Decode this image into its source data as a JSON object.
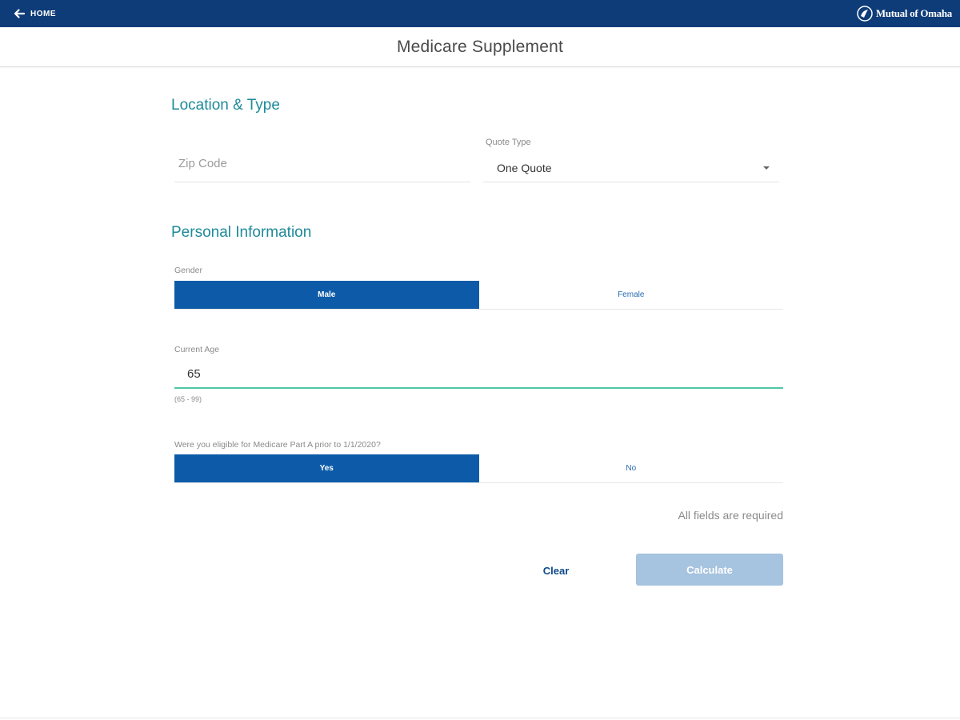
{
  "header": {
    "home_label": "HOME",
    "brand_text": "Mutual of Omaha"
  },
  "page": {
    "title": "Medicare Supplement"
  },
  "location_type": {
    "heading": "Location & Type",
    "zip": {
      "placeholder": "Zip Code",
      "value": ""
    },
    "quote_type": {
      "label": "Quote Type",
      "selected": "One Quote"
    }
  },
  "personal_info": {
    "heading": "Personal Information",
    "gender": {
      "label": "Gender",
      "options": [
        "Male",
        "Female"
      ],
      "selected": "Male"
    },
    "age": {
      "label": "Current Age",
      "value": "65",
      "hint": "(65 - 99)"
    },
    "medicare_eligibility": {
      "label": "Were you eligible for Medicare Part A prior to 1/1/2020?",
      "options": [
        "Yes",
        "No"
      ],
      "selected": "Yes"
    }
  },
  "footer": {
    "required_note": "All fields are required",
    "clear_label": "Clear",
    "calculate_label": "Calculate"
  },
  "colors": {
    "header_bg": "#0e3c78",
    "heading_teal": "#1e8a9a",
    "selected_blue": "#0d5ba8",
    "focus_underline": "#4fc7a4",
    "calculate_disabled": "#a6c3df"
  },
  "icons": {
    "home": "arrow-left-icon",
    "brand": "mutual-of-omaha-logo-icon",
    "select": "caret-down-icon"
  }
}
